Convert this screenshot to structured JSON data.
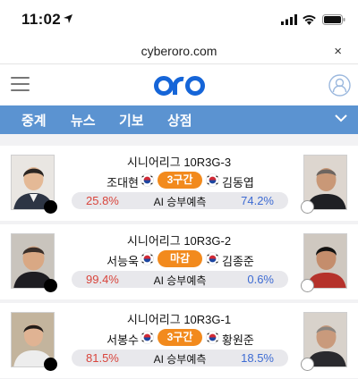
{
  "status": {
    "time": "11:02"
  },
  "browser": {
    "url": "cyberoro.com",
    "close_glyph": "×"
  },
  "header": {
    "logo": "oro"
  },
  "nav": {
    "items": [
      "중계",
      "뉴스",
      "기보",
      "상점"
    ]
  },
  "colors": {
    "nav": "#5b93d1",
    "badge": "#f28a1d",
    "left_pct": "#d9453c",
    "right_pct": "#3d6bd3",
    "logo": "#1565d8"
  },
  "games": [
    {
      "league": "시니어리그 10R3G-3",
      "black": "조대현",
      "white": "김동엽",
      "status": "3구간",
      "black_pct": "25.8%",
      "white_pct": "74.2%",
      "pred_label": "AI 승부예측"
    },
    {
      "league": "시니어리그 10R3G-2",
      "black": "서능욱",
      "white": "김종준",
      "status": "마감",
      "black_pct": "99.4%",
      "white_pct": "0.6%",
      "pred_label": "AI 승부예측"
    },
    {
      "league": "시니어리그 10R3G-1",
      "black": "서봉수",
      "white": "황원준",
      "status": "3구간",
      "black_pct": "81.5%",
      "white_pct": "18.5%",
      "pred_label": "AI 승부예측"
    }
  ]
}
